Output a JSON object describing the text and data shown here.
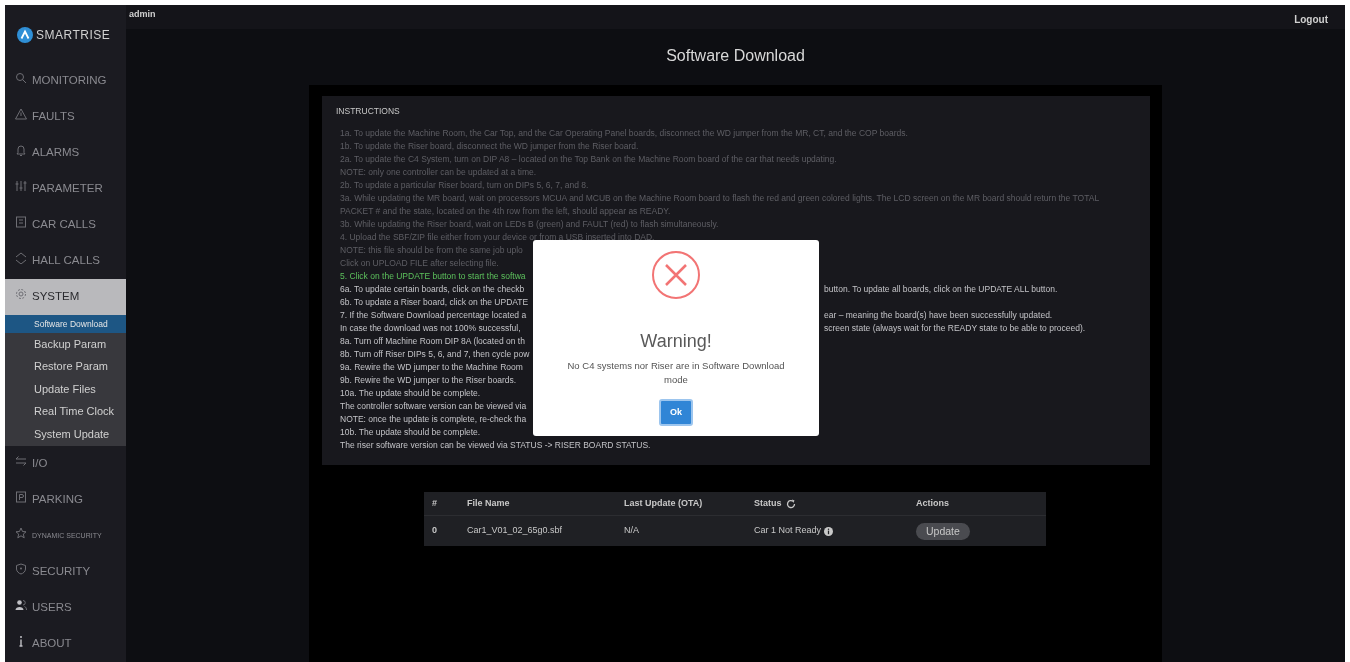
{
  "top_bar": {
    "user": "admin",
    "logout": "Logout"
  },
  "sidebar": {
    "logo": "SMARTRISE",
    "items": [
      {
        "label": "MONITORING",
        "selected": false
      },
      {
        "label": "FAULTS",
        "selected": false
      },
      {
        "label": "ALARMS",
        "selected": false
      },
      {
        "label": "PARAMETER",
        "selected": false
      },
      {
        "label": "CAR CALLS",
        "selected": false
      },
      {
        "label": "HALL CALLS",
        "selected": false
      },
      {
        "label": "SYSTEM",
        "selected": true,
        "children": [
          {
            "label": "Software Download",
            "selected": true
          },
          {
            "label": "Backup Param",
            "selected": false
          },
          {
            "label": "Restore Param",
            "selected": false
          },
          {
            "label": "Update Files",
            "selected": false
          },
          {
            "label": "Real Time Clock",
            "selected": false
          },
          {
            "label": "System Update",
            "selected": false
          }
        ]
      },
      {
        "label": "I/O",
        "selected": false
      },
      {
        "label": "PARKING",
        "selected": false
      },
      {
        "label": "DYNAMIC SECURITY",
        "selected": false,
        "kind": "small"
      },
      {
        "label": "SECURITY",
        "selected": false
      },
      {
        "label": "USERS",
        "selected": false
      },
      {
        "label": "ABOUT",
        "selected": false
      }
    ]
  },
  "page_title": "Software Download",
  "instructions": {
    "heading": "INSTRUCTIONS",
    "lines": [
      {
        "kind": "muted",
        "text": "1a. To update the Machine Room, the Car Top, and the Car Operating Panel boards, disconnect the WD jumper from the MR, CT, and the COP boards."
      },
      {
        "kind": "muted",
        "text": "1b. To update the Riser board, disconnect the WD jumper from the Riser board."
      },
      {
        "kind": "muted",
        "text": "2a. To update the C4 System, turn on DIP A8 – located on the Top Bank on the Machine Room board of the car that needs updating."
      },
      {
        "kind": "muted",
        "text": "NOTE: only one controller can be updated at a time."
      },
      {
        "kind": "muted",
        "text": "2b. To update a particular Riser board, turn on DIPs 5, 6, 7, and 8."
      },
      {
        "kind": "muted",
        "text": "3a. While updating the MR board, wait on processors MCUA and MCUB on the Machine Room board to flash the red and green colored lights. The LCD screen on the MR board should return the TOTAL"
      },
      {
        "kind": "muted",
        "text": "PACKET # and the state, located on the 4th row from the left, should appear as READY."
      },
      {
        "kind": "muted",
        "text": "3b. While updating the Riser board, wait on LEDs B (green) and FAULT (red) to flash simultaneously."
      },
      {
        "kind": "muted",
        "text": "4. Upload the SBF/ZIP file either from your device or from a USB inserted into DAD."
      },
      {
        "kind": "muted",
        "text": "NOTE: this file should be from the same job uplo"
      },
      {
        "kind": "muted",
        "text": "Click on UPLOAD FILE after selecting file."
      },
      {
        "kind": "highlight",
        "text": "5. Click on the UPDATE button to start the softwa"
      },
      {
        "kind": "normal",
        "text": "6a. To update certain boards, click on the checkb",
        "text_right": "button. To update all boards, click on the UPDATE ALL button."
      },
      {
        "kind": "normal",
        "text": "6b. To update a Riser board, click on the UPDATE"
      },
      {
        "kind": "normal",
        "text": "7. If the Software Download percentage located a",
        "text_right": "ear – meaning the board(s) have been successfully updated."
      },
      {
        "kind": "normal",
        "text": "In case the download was not 100% successful,",
        "text_right": "screen state (always wait for the READY state to be able to proceed)."
      },
      {
        "kind": "normal",
        "text": "8a. Turn off Machine Room DIP 8A (located on th"
      },
      {
        "kind": "normal",
        "text": "8b. Turn off Riser DIPs 5, 6, and 7, then cycle pow"
      },
      {
        "kind": "normal",
        "text": "9a. Rewire the WD jumper to the Machine Room"
      },
      {
        "kind": "normal",
        "text": "9b. Rewire the WD jumper to the Riser boards."
      },
      {
        "kind": "normal",
        "text": "10a. The update should be complete."
      },
      {
        "kind": "normal",
        "text": "The controller software version can be viewed via"
      },
      {
        "kind": "normal",
        "text": "NOTE: once the update is complete, re-check tha"
      },
      {
        "kind": "normal",
        "text": "10b. The update should be complete."
      },
      {
        "kind": "normal",
        "text": "The riser software version can be viewed via STATUS -> RISER BOARD STATUS."
      }
    ]
  },
  "table": {
    "columns": [
      "#",
      "File Name",
      "Last Update (OTA)",
      "Status",
      "Actions"
    ],
    "rows": [
      {
        "index": "0",
        "file_name": "Car1_V01_02_65g0.sbf",
        "last_update": "N/A",
        "status": "Car 1 Not Ready",
        "action": "Update"
      }
    ]
  },
  "dialog": {
    "title": "Warning!",
    "message": "No C4 systems nor Riser are in Software Download mode",
    "button": "Ok"
  }
}
